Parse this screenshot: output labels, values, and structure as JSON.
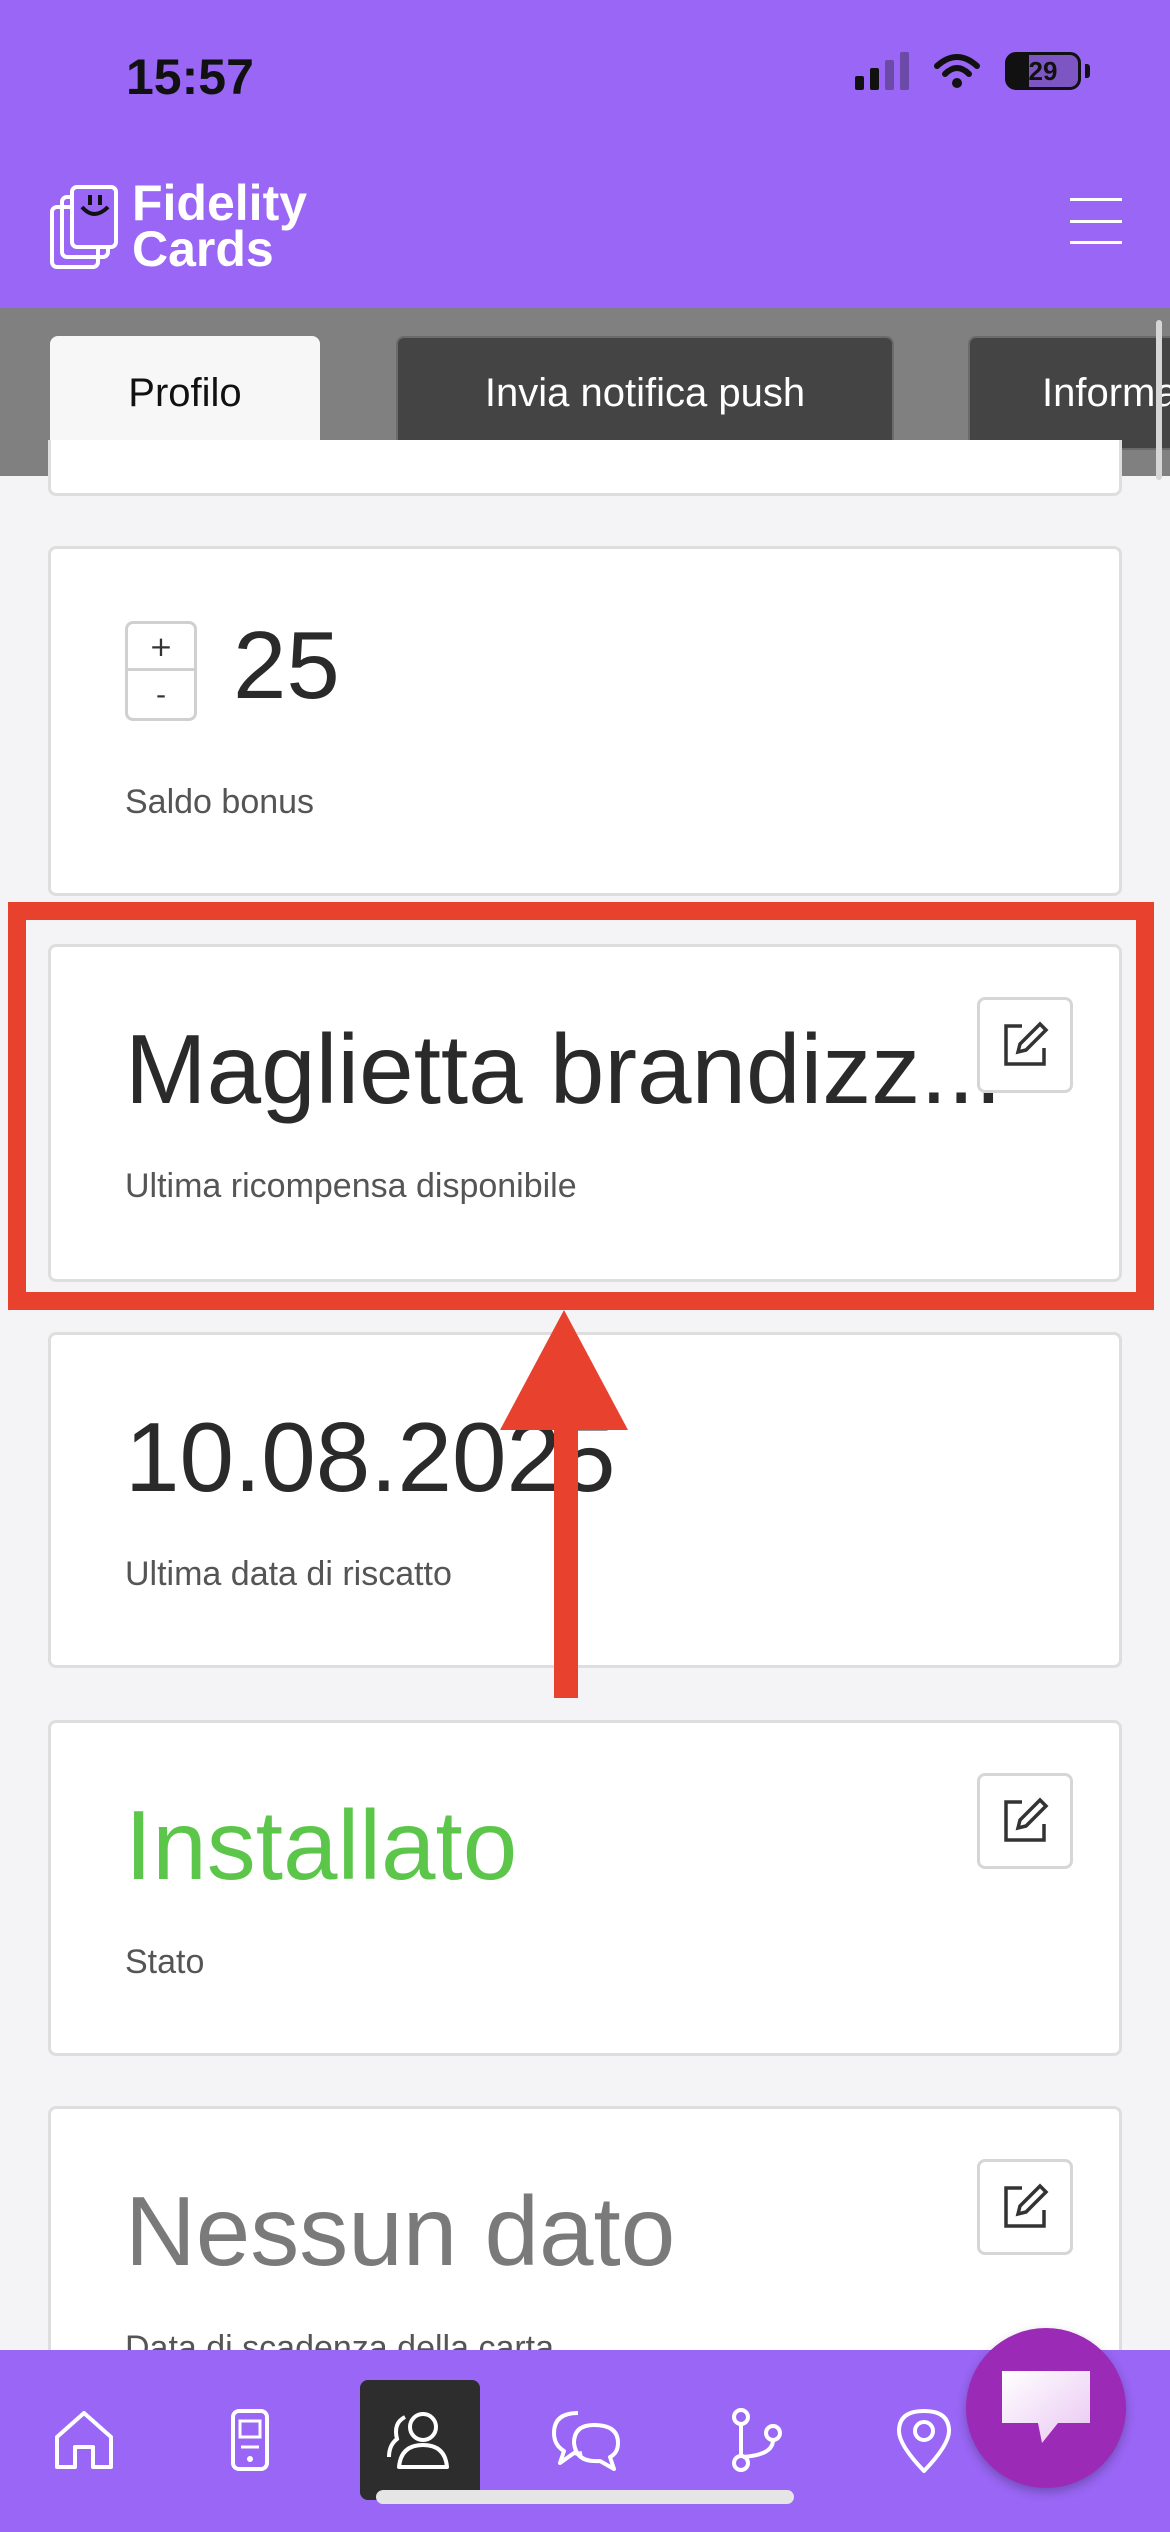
{
  "status_bar": {
    "time": "15:57",
    "battery": "29"
  },
  "header": {
    "logo_line1": "Fidelity",
    "logo_line2": "Cards"
  },
  "tabs": [
    {
      "label": "Profilo",
      "active": true
    },
    {
      "label": "Invia notifica push",
      "active": false
    },
    {
      "label": "Informa",
      "active": false
    }
  ],
  "cards": {
    "bonus": {
      "value": "25",
      "caption": "Saldo bonus",
      "plus": "+",
      "minus": "-"
    },
    "reward": {
      "value": "Maglietta brandizz...",
      "caption": "Ultima ricompensa disponibile"
    },
    "redeem_date": {
      "value": "10.08.2025",
      "caption": "Ultima data di riscatto"
    },
    "status": {
      "value": "Installato",
      "caption": "Stato",
      "color": "#5cc64a"
    },
    "expiry": {
      "value": "Nessun dato",
      "caption": "Data di scadenza della carta"
    }
  },
  "colors": {
    "brand": "#9966f5",
    "highlight": "#e8412d",
    "fab": "#9b2bb6"
  },
  "bottom_nav": {
    "items": [
      "home-icon",
      "device-icon",
      "users-icon",
      "chat-icon",
      "branch-icon",
      "location-icon"
    ],
    "active": "users-icon"
  }
}
